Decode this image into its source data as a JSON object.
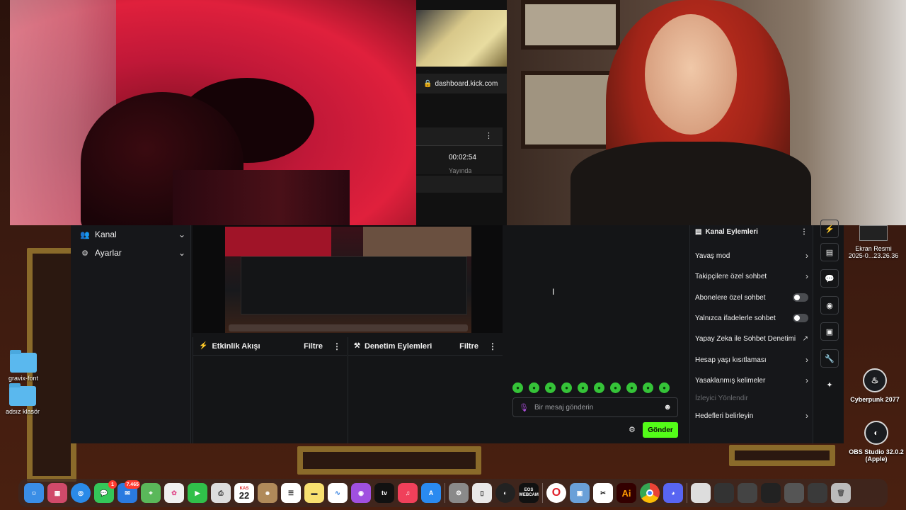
{
  "browser": {
    "url": "dashboard.kick.com",
    "timer": "00:02:54",
    "timer_sub": "Yayında"
  },
  "sidebar": {
    "items": [
      {
        "label": "Kanal",
        "icon": "users-icon"
      },
      {
        "label": "Ayarlar",
        "icon": "gear-icon"
      }
    ]
  },
  "panels": {
    "activity": {
      "title": "Etkinlik Akışı",
      "filter": "Filtre"
    },
    "moderation": {
      "title": "Denetim Eylemleri",
      "filter": "Filtre"
    }
  },
  "chat": {
    "placeholder": "Bir mesaj gönderin",
    "send_label": "Gönder",
    "emote_count": 10
  },
  "channel_actions": {
    "title": "Kanal Eylemleri",
    "items": [
      {
        "label": "Yavaş mod",
        "control": "chevron"
      },
      {
        "label": "Takipçilere özel sohbet",
        "control": "chevron"
      },
      {
        "label": "Abonelere özel sohbet",
        "control": "toggle"
      },
      {
        "label": "Yalnızca ifadelerle sohbet",
        "control": "toggle"
      },
      {
        "label": "Yapay Zeka ile Sohbet Denetimi",
        "control": "external"
      },
      {
        "label": "Hesap yaşı kısıtlaması",
        "control": "chevron"
      },
      {
        "label": "Yasaklanmış kelimeler",
        "control": "chevron"
      },
      {
        "label": "İzleyici Yönlendir",
        "control": "disabled"
      },
      {
        "label": "Hedefleri belirleyin",
        "control": "chevron"
      }
    ]
  },
  "toolbar": {
    "icons": [
      "lightning-icon",
      "document-icon",
      "chat-icon",
      "broadcast-icon",
      "camera-icon",
      "wrench-icon",
      "sparkle-icon"
    ]
  },
  "desktop": {
    "left_icons": [
      {
        "label": "gravix-font"
      },
      {
        "label": "adsız klasör"
      }
    ],
    "right_icons": [
      {
        "label": "Ekran Resmi\n2025-0...23.26.36"
      },
      {
        "label": "Cyberpunk 2077"
      },
      {
        "label": "OBS Studio 32.0.2\n(Apple)"
      }
    ]
  },
  "dock": {
    "calendar_month": "KAS",
    "calendar_day": "22",
    "mail_badge": "7.465",
    "messages_badge": "1",
    "eos_label": "EOS\nWEBCAM",
    "ai_label": "Ai"
  }
}
